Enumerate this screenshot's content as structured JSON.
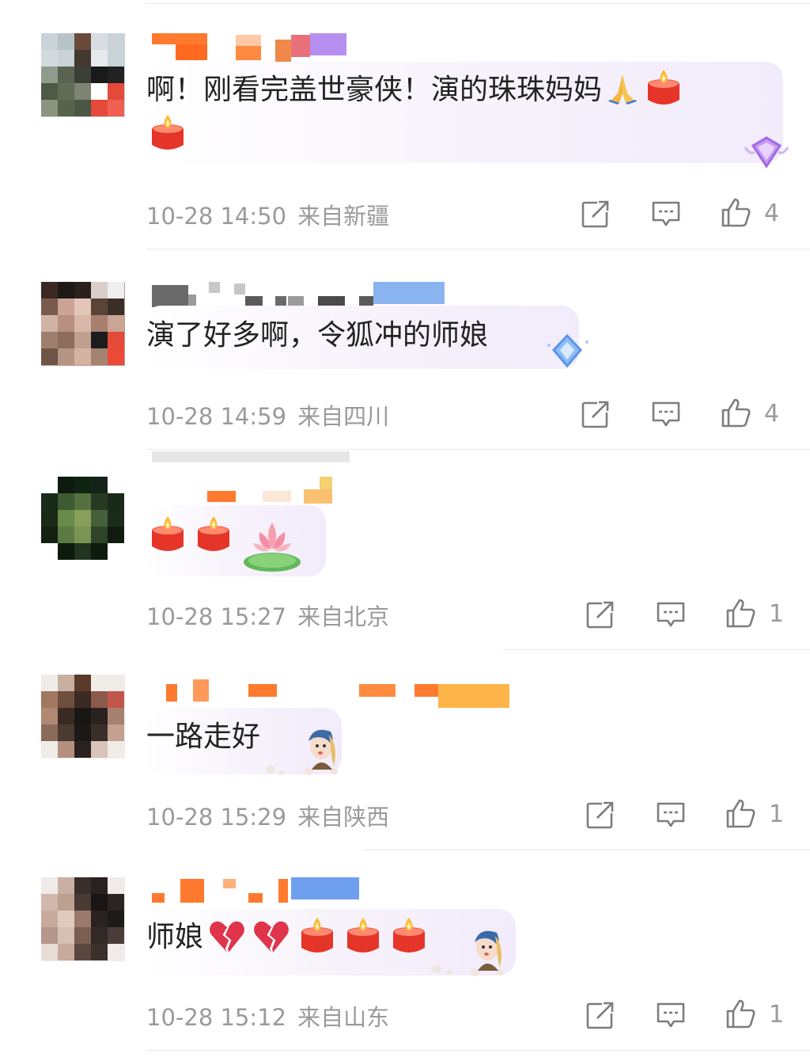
{
  "colors": {
    "text": "#222222",
    "meta": "#9a9a9a",
    "divider": "#e8e8e8",
    "icon": "#7d7d7d"
  },
  "icons": [
    "forward-icon",
    "reply-icon",
    "like-icon",
    "candle-emoji",
    "pray-emoji",
    "lotus-emoji",
    "broken-heart-emoji",
    "pearl-girl-sticker",
    "diamond-badge"
  ],
  "comments": [
    {
      "text_line1": "啊！刚看完盖世豪侠！演的珠珠妈妈",
      "time": "10-28 14:50",
      "location": "来自新疆",
      "likes": "4"
    },
    {
      "text": "演了好多啊，令狐冲的师娘",
      "time": "10-28 14:59",
      "location": "来自四川",
      "likes": "4"
    },
    {
      "text": "",
      "time": "10-28 15:27",
      "location": "来自北京",
      "likes": "1"
    },
    {
      "text": "一路走好",
      "time": "10-28 15:29",
      "location": "来自陕西",
      "likes": "1"
    },
    {
      "text": "师娘",
      "time": "10-28 15:12",
      "location": "来自山东",
      "likes": "1"
    }
  ]
}
